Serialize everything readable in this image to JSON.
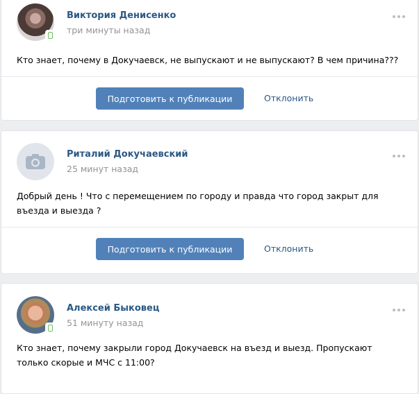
{
  "posts": [
    {
      "author": "Виктория Денисенко",
      "time": "три минуты назад",
      "avatar": "photo-female",
      "mobile": true,
      "text": "Кто знает, почему в Докучаевск, не выпускают и не выпускают? В чем причина???"
    },
    {
      "author": "Риталий Докучаевский",
      "time": "25 минут назад",
      "avatar": "camera-placeholder-icon",
      "mobile": false,
      "text": "Добрый день ! Что с перемещением по городу и правда что город закрыт для въезда и выезда ?"
    },
    {
      "author": "Алексей Быковец",
      "time": "51 минуту назад",
      "avatar": "photo-male",
      "mobile": true,
      "text": "Кто знает, почему закрыли город Докучаевск на въезд и выезд. Пропускают только скорые и МЧС с 11:00?"
    }
  ],
  "actions": {
    "publish_label": "Подготовить к публикации",
    "reject_label": "Отклонить"
  },
  "colors": {
    "accent": "#5181b8",
    "link": "#2a5885",
    "muted": "#939393",
    "background": "#edeef0"
  }
}
